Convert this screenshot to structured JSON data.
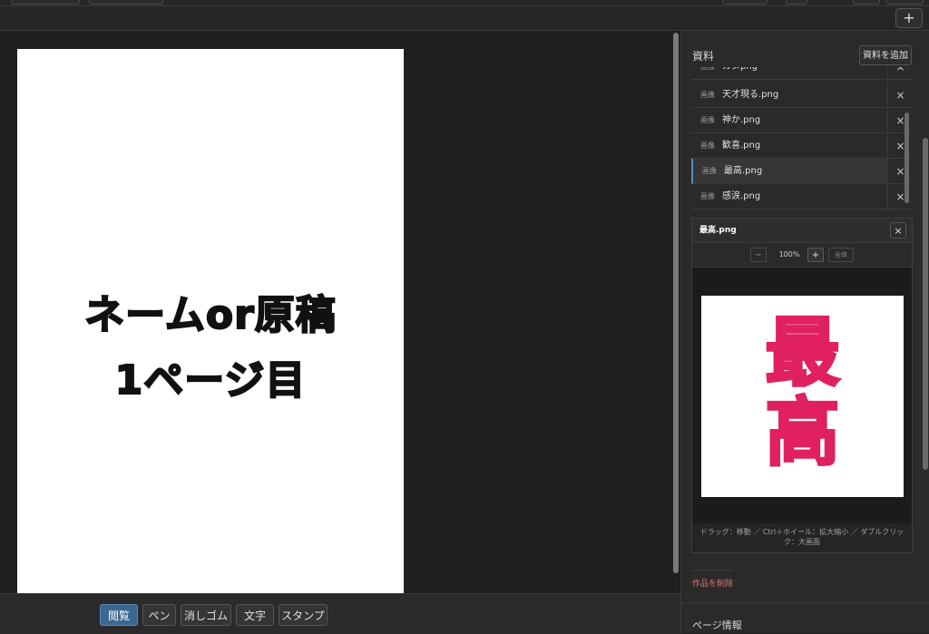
{
  "canvas": {
    "page_text_line1": "ネームor原稿",
    "page_text_line2": "1ページ目"
  },
  "toolbar": {
    "tools": [
      "閲覧",
      "ペン",
      "消しゴム",
      "文字",
      "スタンプ"
    ],
    "active_tool": "閲覧"
  },
  "header": {
    "add_tab_label": "+"
  },
  "materials": {
    "title": "資料",
    "add_button": "資料を追加",
    "kind_label": "画像",
    "items": [
      {
        "name": "カヌpng",
        "selected": false
      },
      {
        "name": "天才現る.png",
        "selected": false
      },
      {
        "name": "神か.png",
        "selected": false
      },
      {
        "name": "歓喜.png",
        "selected": false
      },
      {
        "name": "最高.png",
        "selected": true
      },
      {
        "name": "感涙.png",
        "selected": false
      }
    ],
    "remove_label": "×"
  },
  "preview": {
    "file_name": "最高.png",
    "close_label": "×",
    "zoom_out": "−",
    "zoom_level": "100%",
    "zoom_in": "+",
    "fit_label": "全体",
    "image_text_line1": "最",
    "image_text_line2": "高",
    "image_color": "#e0205f",
    "hint": "ドラッグ：移動 ／ Ctrl＋ホイール：拡大縮小 ／ ダブルクリック：大画面"
  },
  "delete_work": "作品を削除",
  "page_info_title": "ページ情報",
  "colors": {
    "accent": "#3d6690",
    "danger": "#e07070"
  }
}
